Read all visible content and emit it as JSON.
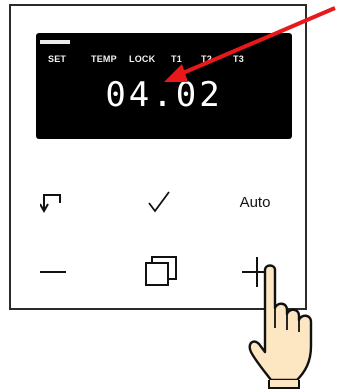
{
  "display": {
    "modes": [
      "SET",
      "TEMP",
      "LOCK",
      "T1",
      "T2",
      "T3"
    ],
    "time": "04.02"
  },
  "buttons": {
    "auto_label": "Auto"
  },
  "icons": {
    "back": "return-arrow-icon",
    "confirm": "checkmark-icon",
    "minus": "minus-icon",
    "copy": "copy-squares-icon",
    "plus": "plus-icon",
    "annotation_arrow": "red-arrow-icon",
    "hand": "pointing-hand-icon"
  },
  "colors": {
    "display_bg": "#000000",
    "display_text": "#ffffff",
    "arrow": "#e8181b",
    "hand_fill": "#fde6c2"
  }
}
